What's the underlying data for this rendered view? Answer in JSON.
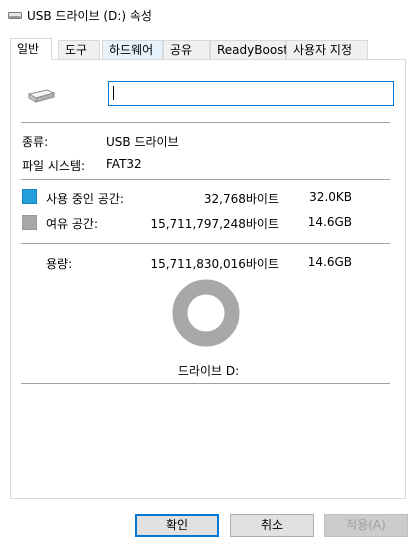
{
  "window": {
    "title": "USB 드라이브 (D:) 속성"
  },
  "tabs": [
    {
      "label": "일반",
      "active": true
    },
    {
      "label": "도구"
    },
    {
      "label": "하드웨어",
      "hover": true
    },
    {
      "label": "공유"
    },
    {
      "label": "ReadyBoost"
    },
    {
      "label": "사용자 지정"
    }
  ],
  "general": {
    "name_value": "",
    "type_label": "종류:",
    "type_value": "USB 드라이브",
    "fs_label": "파일 시스템:",
    "fs_value": "FAT32",
    "used": {
      "label": "사용 중인 공간:",
      "bytes": "32,768바이트",
      "size": "32.0KB",
      "color": "#26a0da"
    },
    "free": {
      "label": "여유 공간:",
      "bytes": "15,711,797,248바이트",
      "size": "14.6GB",
      "color": "#a8a8a8"
    },
    "capacity": {
      "label": "용량:",
      "bytes": "15,711,830,016바이트",
      "size": "14.6GB"
    },
    "used_fraction": 2.1e-06,
    "drive_label": "드라이브 D:"
  },
  "icons": {
    "title": "drive-icon",
    "drive": "usb-drive-icon"
  },
  "buttons": {
    "ok": "확인",
    "cancel": "취소",
    "apply": "적용(A)"
  }
}
